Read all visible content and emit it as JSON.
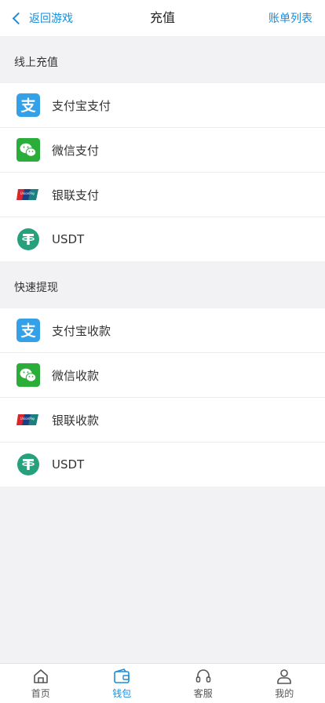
{
  "header": {
    "back_label": "返回游戏",
    "title": "充值",
    "right_link": "账单列表"
  },
  "sections": [
    {
      "title": "线上充值",
      "items": [
        {
          "label": "支付宝支付",
          "icon": "alipay-icon"
        },
        {
          "label": "微信支付",
          "icon": "wechat-icon"
        },
        {
          "label": "银联支付",
          "icon": "unionpay-icon"
        },
        {
          "label": "USDT",
          "icon": "usdt-icon"
        }
      ]
    },
    {
      "title": "快速提现",
      "items": [
        {
          "label": "支付宝收款",
          "icon": "alipay-icon"
        },
        {
          "label": "微信收款",
          "icon": "wechat-icon"
        },
        {
          "label": "银联收款",
          "icon": "unionpay-icon"
        },
        {
          "label": "USDT",
          "icon": "usdt-icon"
        }
      ]
    }
  ],
  "tabbar": {
    "items": [
      {
        "label": "首页",
        "icon": "home-icon"
      },
      {
        "label": "钱包",
        "icon": "wallet-icon",
        "active": true
      },
      {
        "label": "客服",
        "icon": "headset-icon"
      },
      {
        "label": "我的",
        "icon": "user-icon"
      }
    ]
  },
  "colors": {
    "accent": "#1a8ed8",
    "alipay": "#33a0e8",
    "wechat": "#2aae39",
    "usdt": "#27a17b"
  }
}
